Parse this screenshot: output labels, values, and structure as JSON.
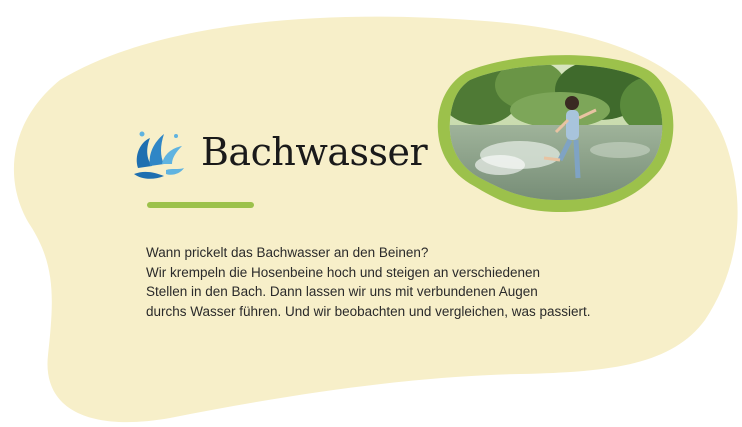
{
  "colors": {
    "background": "#ffffff",
    "blob": "#f7efc9",
    "accent_green": "#9cc14b",
    "logo_blue_dark": "#1e6fb0",
    "logo_blue_light": "#5fb3e0",
    "title_text": "#1a1a1a",
    "body_text": "#2a2a2a"
  },
  "logo": {
    "icon": "water-splash-icon"
  },
  "title": "Bachwasser",
  "photo": {
    "description_icon": "child-splashing-in-stream-photo"
  },
  "body": {
    "lines": [
      "Wann prickelt das Bachwasser an den Beinen?",
      "Wir krempeln die Hosenbeine hoch und steigen an verschiedenen",
      "Stellen in den Bach. Dann lassen wir uns mit verbundenen Augen",
      "durchs Wasser führen. Und wir beobachten und vergleichen, was passiert."
    ]
  }
}
